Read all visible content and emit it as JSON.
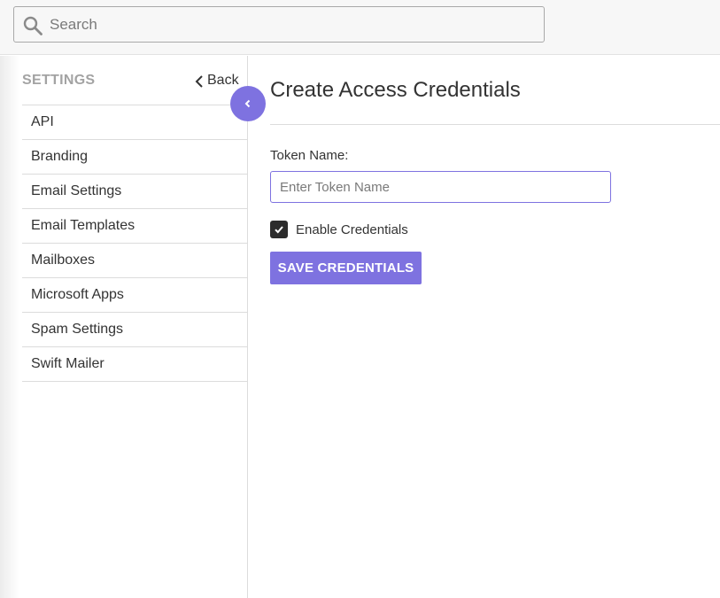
{
  "search": {
    "placeholder": "Search",
    "icon": "search-icon"
  },
  "sidebar": {
    "title": "SETTINGS",
    "back_label": "Back",
    "items": [
      {
        "label": "API"
      },
      {
        "label": "Branding"
      },
      {
        "label": "Email Settings"
      },
      {
        "label": "Email Templates"
      },
      {
        "label": "Mailboxes"
      },
      {
        "label": "Microsoft Apps"
      },
      {
        "label": "Spam Settings"
      },
      {
        "label": "Swift Mailer"
      }
    ],
    "collapse_icon": "chevron-left-icon"
  },
  "main": {
    "title": "Create Access Credentials",
    "token_label": "Token Name:",
    "token_placeholder": "Enter Token Name",
    "token_value": "",
    "enable_label": "Enable Credentials",
    "enable_checked": true,
    "save_label": "SAVE CREDENTIALS"
  },
  "colors": {
    "accent": "#7e72e0",
    "checkbox": "#2c2c2c",
    "muted_heading": "#a3a3a3",
    "text": "#333333"
  }
}
